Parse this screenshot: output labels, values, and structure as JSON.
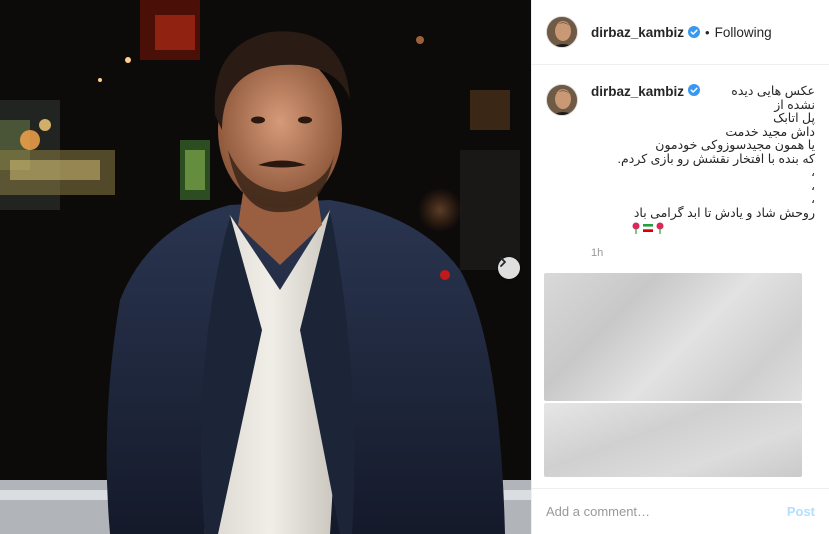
{
  "post": {
    "photo_alt": "",
    "next_icon": "chevron-right-icon"
  },
  "header": {
    "username": "dirbaz_kambiz",
    "verified_icon": "verified-badge-icon",
    "separator": "•",
    "follow_state": "Following"
  },
  "caption": {
    "username": "dirbaz_kambiz",
    "first_line": "عکس هایی دیده نشده از",
    "lines": [
      "پل اتابک",
      "داش مجید خدمت",
      "یا همون مجیدسوزوکی خودمون",
      "که بنده با افتخار نقشش رو بازی کردم.",
      "،",
      "،",
      "،",
      "روحش شاد و یادش تا ابد گرامی باد"
    ],
    "emoji": "rose-icon iran-flag-icon rose-icon",
    "time": "1h"
  },
  "comment_box": {
    "placeholder": "Add a comment…",
    "post_label": "Post"
  },
  "colors": {
    "verified_blue": "#3897f0",
    "post_disabled": "#b2dffc",
    "border": "#efefef"
  }
}
